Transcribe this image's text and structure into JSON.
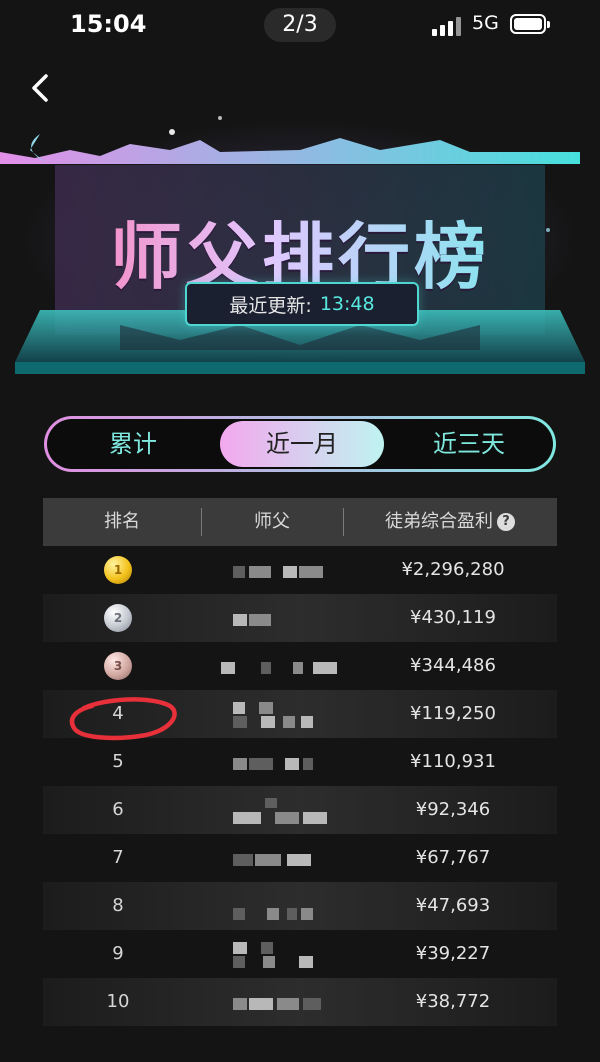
{
  "status_bar": {
    "time": "15:04",
    "pager": "2/3",
    "network": "5G"
  },
  "banner": {
    "title": "师父排行榜",
    "update_label": "最近更新:",
    "update_time": "13:48"
  },
  "tabs": [
    {
      "label": "累计",
      "active": false
    },
    {
      "label": "近一月",
      "active": true
    },
    {
      "label": "近三天",
      "active": false
    }
  ],
  "table": {
    "headers": {
      "rank": "排名",
      "master": "师父",
      "profit": "徒弟综合盈利"
    },
    "rows": [
      {
        "rank": "1",
        "medal": "gold",
        "profit": "¥2,296,280"
      },
      {
        "rank": "2",
        "medal": "silver",
        "profit": "¥430,119"
      },
      {
        "rank": "3",
        "medal": "bronze",
        "profit": "¥344,486"
      },
      {
        "rank": "4",
        "profit": "¥119,250"
      },
      {
        "rank": "5",
        "profit": "¥110,931"
      },
      {
        "rank": "6",
        "profit": "¥92,346"
      },
      {
        "rank": "7",
        "profit": "¥67,767"
      },
      {
        "rank": "8",
        "profit": "¥47,693"
      },
      {
        "rank": "9",
        "profit": "¥39,227"
      },
      {
        "rank": "10",
        "profit": "¥38,772"
      }
    ]
  },
  "colors": {
    "accent_cyan": "#58e8df",
    "accent_pink": "#f3a8ee",
    "annotation_red": "#e8303a"
  }
}
